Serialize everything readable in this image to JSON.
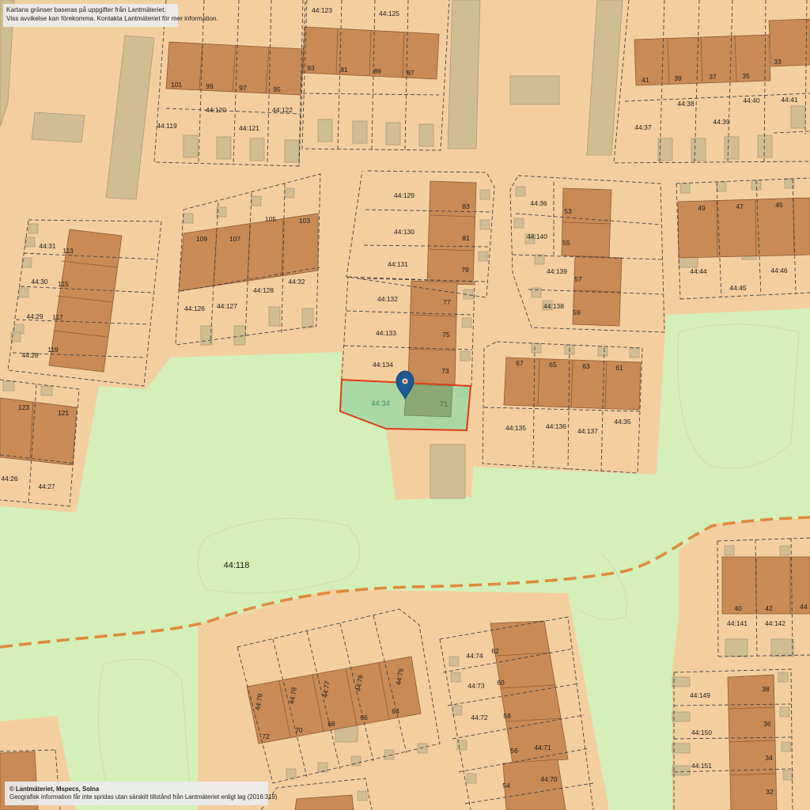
{
  "map": {
    "colors": {
      "land": "#f3cf9f",
      "green": "#d4efb9",
      "building": "#c98a55",
      "outbuilding": "#d1bd93",
      "property_line": "#444444",
      "boundary": "#e08a3c",
      "highlight_fill": "#9fd8a6",
      "highlight_border": "#e13a17",
      "marker": "#1e5a92"
    },
    "notice": {
      "line1": "Kartans gränser baseras på uppgifter från Lantmäteriet.",
      "line2": "Viss avvikelse kan förekomma. Kontakta Lantmäteriet för mer information."
    },
    "copyright": {
      "line1": "© Lantmäteriet, Mspecs, Solna",
      "line2": "Geografisk information får inte spridas utan särskilt tillstånd från Lantmäteriet enligt lag (2016:319)"
    },
    "selected_parcel": {
      "label": "44:34",
      "house_number": "71",
      "marker_icon": "map-pin-icon"
    },
    "large_parcel_label": "44:118",
    "house_numbers": [
      "101",
      "99",
      "97",
      "95",
      "93",
      "91",
      "89",
      "87",
      "41",
      "39",
      "37",
      "35",
      "33",
      "113",
      "115",
      "117",
      "119",
      "109",
      "107",
      "105",
      "103",
      "83",
      "81",
      "79",
      "77",
      "75",
      "73",
      "53",
      "55",
      "57",
      "59",
      "49",
      "47",
      "45",
      "67",
      "65",
      "63",
      "61",
      "123",
      "121",
      "40",
      "42",
      "44",
      "62",
      "60",
      "58",
      "56",
      "54",
      "38",
      "36",
      "34",
      "32",
      "72",
      "70",
      "68",
      "66",
      "64"
    ],
    "parcel_labels": [
      "44:123",
      "44:125",
      "44:120",
      "44:121",
      "44:122",
      "44:119",
      "44:38",
      "44:39",
      "44:40",
      "44:41",
      "44:37",
      "44:31",
      "44:30",
      "44:29",
      "44:28",
      "44:126",
      "44:127",
      "44:128",
      "44:32",
      "44:129",
      "44:130",
      "44:131",
      "44:132",
      "44:133",
      "44:134",
      "44:36",
      "44:140",
      "44:139",
      "44:138",
      "44:44",
      "44:45",
      "44:46",
      "44:135",
      "44:136",
      "44:137",
      "44:35",
      "44:26",
      "44:27",
      "44:141",
      "44:142",
      "44:74",
      "44:73",
      "44:72",
      "44:71",
      "44:70",
      "44:149",
      "44:150",
      "44:151",
      "44:79",
      "44:78",
      "44:77",
      "44:76",
      "44:75"
    ]
  }
}
